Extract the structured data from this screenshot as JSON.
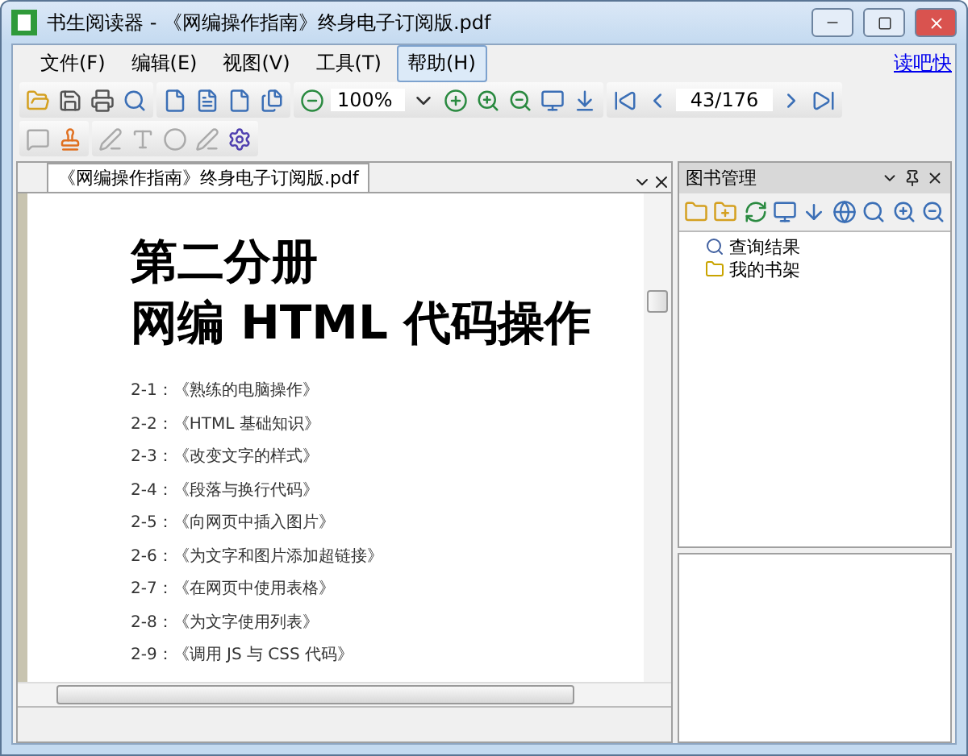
{
  "window": {
    "title": "书生阅读器 - 《网编操作指南》终身电子订阅版.pdf"
  },
  "menu": {
    "items": [
      {
        "label": "文件(F)",
        "selected": false
      },
      {
        "label": "编辑(E)",
        "selected": false
      },
      {
        "label": "视图(V)",
        "selected": false
      },
      {
        "label": "工具(T)",
        "selected": false
      },
      {
        "label": "帮助(H)",
        "selected": true
      }
    ],
    "link": "读吧快"
  },
  "toolbar": {
    "zoom": "100%",
    "page": "43/176"
  },
  "document": {
    "tab": "《网编操作指南》终身电子订阅版.pdf",
    "heading": [
      "第二分册",
      "网编 HTML 代码操作"
    ],
    "toc": [
      "2-1：《熟练的电脑操作》",
      "2-2：《HTML 基础知识》",
      "2-3：《改变文字的样式》",
      "2-4：《段落与换行代码》",
      "2-5：《向网页中插入图片》",
      "2-6：《为文字和图片添加超链接》",
      "2-7：《在网页中使用表格》",
      "2-8：《为文字使用列表》",
      "2-9：《调用 JS 与 CSS 代码》"
    ]
  },
  "side_panel": {
    "title": "图书管理",
    "tree": [
      {
        "label": "查询结果",
        "kind": "search"
      },
      {
        "label": "我的书架",
        "kind": "folder"
      }
    ]
  }
}
